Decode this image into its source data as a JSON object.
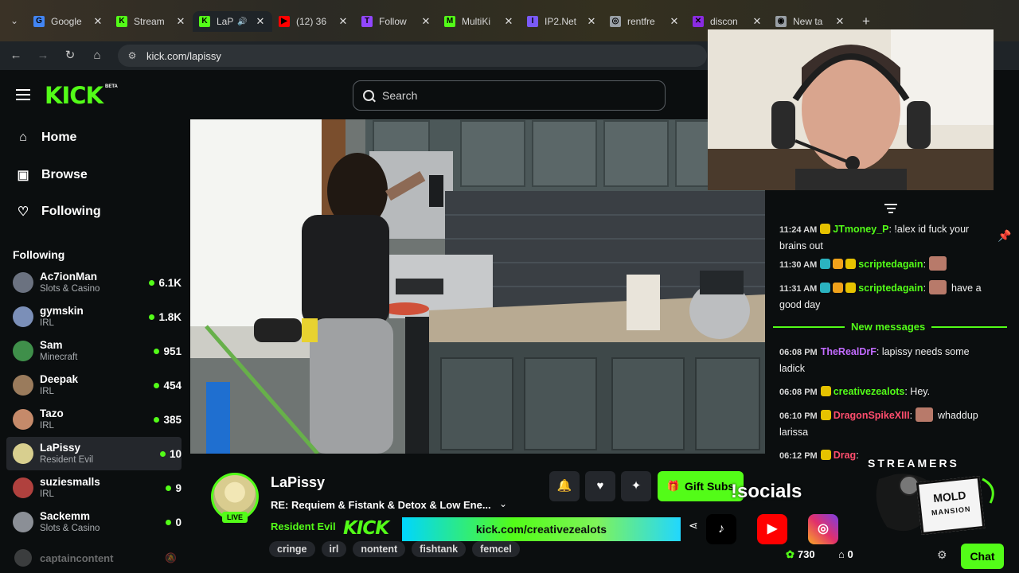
{
  "browser": {
    "tabs": [
      {
        "title": "Google",
        "icon": "google-icon",
        "color": "#4285f4",
        "active": false,
        "letter": "G"
      },
      {
        "title": "Stream",
        "icon": "kick-favicon-icon",
        "color": "#53fc18",
        "active": false,
        "letter": "K"
      },
      {
        "title": "LaP",
        "icon": "kick-favicon-icon",
        "color": "#53fc18",
        "active": true,
        "letter": "K",
        "audio": true
      },
      {
        "title": "(12) 36",
        "icon": "youtube-icon",
        "color": "#ff0000",
        "active": false,
        "letter": "▶"
      },
      {
        "title": "Follow",
        "icon": "twitch-icon",
        "color": "#9146ff",
        "active": false,
        "letter": "T"
      },
      {
        "title": "MultiKi",
        "icon": "multikick-icon",
        "color": "#53fc18",
        "active": false,
        "letter": "M"
      },
      {
        "title": "IP2.Net",
        "icon": "ip2-icon",
        "color": "#7a5af8",
        "active": false,
        "letter": "I"
      },
      {
        "title": "rentfre",
        "icon": "globe-icon",
        "color": "#9aa0a6",
        "active": false,
        "letter": "◎"
      },
      {
        "title": "discon",
        "icon": "discord-icon",
        "color": "#8a2be2",
        "active": false,
        "letter": "✕"
      },
      {
        "title": "New ta",
        "icon": "chrome-icon",
        "color": "#9aa0a6",
        "active": false,
        "letter": "◉"
      }
    ],
    "url": "kick.com/lapissy"
  },
  "kick": {
    "logo": "KICK",
    "logo_beta": "BETA",
    "search_placeholder": "Search",
    "nav": [
      {
        "label": "Home",
        "icon": "home-icon"
      },
      {
        "label": "Browse",
        "icon": "browse-icon"
      },
      {
        "label": "Following",
        "icon": "heart-icon"
      }
    ],
    "following_heading": "Following",
    "following": [
      {
        "name": "Ac7ionMan",
        "category": "Slots & Casino",
        "viewers": "6.1K",
        "avatar": "#6b7280"
      },
      {
        "name": "gymskin",
        "category": "IRL",
        "viewers": "1.8K",
        "avatar": "#7b8fb8"
      },
      {
        "name": "Sam",
        "category": "Minecraft",
        "viewers": "951",
        "avatar": "#3f8f4a"
      },
      {
        "name": "Deepak",
        "category": "IRL",
        "viewers": "454",
        "avatar": "#9a7b5c"
      },
      {
        "name": "Tazo",
        "category": "IRL",
        "viewers": "385",
        "avatar": "#c58a6a"
      },
      {
        "name": "LaPissy",
        "category": "Resident Evil",
        "viewers": "10",
        "avatar": "#d8cf8f",
        "selected": true
      },
      {
        "name": "suziesmalls",
        "category": "IRL",
        "viewers": "9",
        "avatar": "#b0413e"
      },
      {
        "name": "Sackemm",
        "category": "Slots & Casino",
        "viewers": "0",
        "avatar": "#8b8f96"
      }
    ],
    "offline": {
      "name": "captaincontent"
    },
    "stream": {
      "streamer": "LaPissy",
      "title": "RE: Requiem & Fistank & Detox & Low Ene...",
      "category": "Resident Evil",
      "live_label": "LIVE",
      "tags": [
        "cringe",
        "irl",
        "nontent",
        "fishtank",
        "femcel"
      ],
      "gift_label": "Gift Subs"
    },
    "chat": {
      "messages": [
        {
          "time": "11:24 AM",
          "user": "JTmoney_P",
          "color": "#53fc18",
          "text": "!alex id fuck your brains out",
          "badges": [
            "#e6c200"
          ]
        },
        {
          "time": "11:30 AM",
          "user": "scriptedagain",
          "color": "#53fc18",
          "text": "",
          "badges": [
            "#2bb3c0",
            "#f0a21b",
            "#e6c200"
          ],
          "emote": true
        },
        {
          "time": "11:31 AM",
          "user": "scriptedagain",
          "color": "#53fc18",
          "text": "have a good day",
          "badges": [
            "#2bb3c0",
            "#f0a21b",
            "#e6c200"
          ],
          "emote": true
        },
        {
          "time": "06:08 PM",
          "user": "TheRealDrF",
          "color": "#c26bff",
          "text": "lapissy needs some ladick",
          "badges": []
        },
        {
          "time": "06:08 PM",
          "user": "creativezealots",
          "color": "#53fc18",
          "text": "Hey.",
          "badges": [
            "#e6c200"
          ]
        },
        {
          "time": "06:10 PM",
          "user": "DragonSpikeXIII",
          "color": "#ff4d6d",
          "text": "whaddup larissa",
          "badges": [
            "#e6c200"
          ],
          "emote": true
        },
        {
          "time": "06:12 PM",
          "user": "Drag",
          "color": "#ff4d6d",
          "text": "",
          "badges": [
            "#e6c200"
          ]
        }
      ],
      "new_messages_label": "New messages",
      "points": "730",
      "gift_count": "0",
      "chat_button": "Chat"
    }
  },
  "overlays": {
    "socials": "!socials",
    "promo_logo": "KICK",
    "promo_url": "kick.com/creativezealots",
    "mold_title": "STREAMERS",
    "mold_line1": "MOLD",
    "mold_line2": "MANSION",
    "social_icons": [
      "tiktok-icon",
      "youtube-icon",
      "instagram-icon"
    ]
  },
  "colors": {
    "accent": "#53fc18",
    "background": "#0b0e0f"
  }
}
